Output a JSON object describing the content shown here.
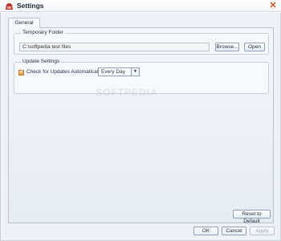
{
  "window": {
    "title": "Settings",
    "close_icon": "close-icon"
  },
  "tabs": [
    {
      "label": "General",
      "selected": true
    }
  ],
  "temporary_folder": {
    "group_title": "Temporary Folder",
    "path_value": "C:\\softpedia test files",
    "browse_label": "Browse...",
    "open_label": "Open"
  },
  "update_settings": {
    "group_title": "Update Settings",
    "checkbox_label": "Check for Updates Automatically:",
    "checked": true,
    "frequency_value": "Every Day"
  },
  "watermark": "SOFTPEDIA",
  "buttons": {
    "reset_label": "Reset to Default",
    "ok_label": "OK",
    "cancel_label": "Cancel",
    "apply_label": "Apply"
  },
  "colors": {
    "accent": "#e8973e",
    "close": "#d9532c"
  }
}
